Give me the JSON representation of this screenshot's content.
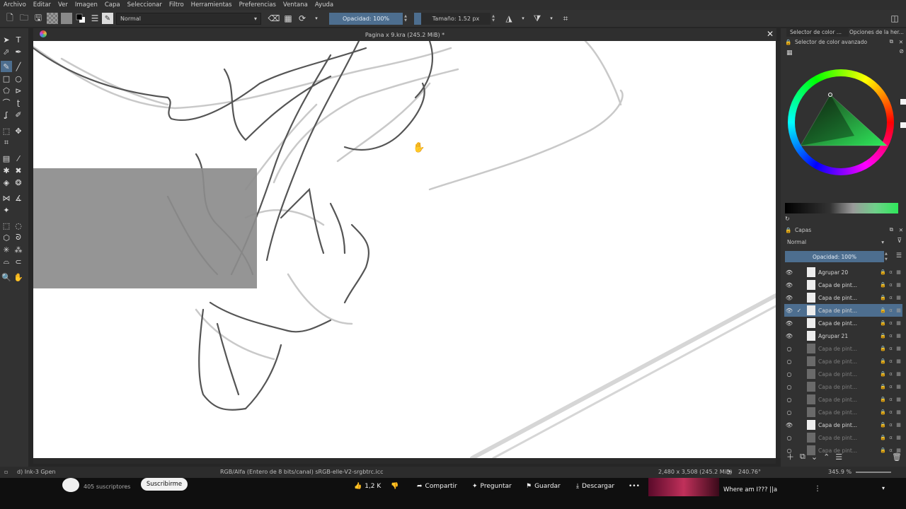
{
  "menu": [
    "Archivo",
    "Editar",
    "Ver",
    "Imagen",
    "Capa",
    "Seleccionar",
    "Filtro",
    "Herramientas",
    "Preferencias",
    "Ventana",
    "Ayuda"
  ],
  "toolbar": {
    "blend_mode": "Normal",
    "opacity_label": "Opacidad: 100%",
    "opacity_value": 1.0,
    "size_label": "Tamaño: 1.52 px"
  },
  "document": {
    "title": "Pagina x 9.kra (245.2 MiB) *"
  },
  "dockers": {
    "tab1": "Selector de color ...",
    "tab2": "Opciones de la her...",
    "color_selector_title": "Selector de color avanzado",
    "layers_title": "Capas",
    "layers_blend": "Normal",
    "layers_opacity": "Opacidad:  100%"
  },
  "layers": [
    {
      "name": "Agrupar 20",
      "visible": true,
      "dim": false,
      "selected": false,
      "group": true
    },
    {
      "name": "Capa de pint...",
      "visible": true,
      "dim": false,
      "selected": false,
      "group": false
    },
    {
      "name": "Capa de pint...",
      "visible": true,
      "dim": false,
      "selected": false,
      "group": false
    },
    {
      "name": "Capa de pint...",
      "visible": true,
      "dim": false,
      "selected": true,
      "group": false
    },
    {
      "name": "Capa de pint...",
      "visible": true,
      "dim": false,
      "selected": false,
      "group": false
    },
    {
      "name": "Agrupar 21",
      "visible": true,
      "dim": false,
      "selected": false,
      "group": true
    },
    {
      "name": "Capa de pint...",
      "visible": false,
      "dim": true,
      "selected": false,
      "group": false
    },
    {
      "name": "Capa de pint...",
      "visible": false,
      "dim": true,
      "selected": false,
      "group": false
    },
    {
      "name": "Capa de pint...",
      "visible": false,
      "dim": true,
      "selected": false,
      "group": false
    },
    {
      "name": "Capa de pint...",
      "visible": false,
      "dim": true,
      "selected": false,
      "group": false
    },
    {
      "name": "Capa de pint...",
      "visible": false,
      "dim": true,
      "selected": false,
      "group": false
    },
    {
      "name": "Capa de pint...",
      "visible": false,
      "dim": true,
      "selected": false,
      "group": false
    },
    {
      "name": "Capa de pint...",
      "visible": true,
      "dim": false,
      "selected": false,
      "group": false
    },
    {
      "name": "Capa de pint...",
      "visible": false,
      "dim": true,
      "selected": false,
      "group": false
    },
    {
      "name": "Capa de pint...",
      "visible": false,
      "dim": true,
      "selected": false,
      "group": false
    }
  ],
  "status": {
    "brush": "d) Ink-3 Gpen",
    "color_space": "RGB/Alfa (Entero de 8 bits/canal)  sRGB-elle-V2-srgbtrc.icc",
    "image_size": "2,480 x 3,508 (245.2 MiB)",
    "rotation": "240.76°",
    "zoom": "345.9 %"
  },
  "youtube": {
    "subscribers": "405 suscriptores",
    "subscribe": "Suscribirme",
    "likes": "1,2 K",
    "share": "Compartir",
    "ask": "Preguntar",
    "save": "Guardar",
    "download": "Descargar",
    "more": "•••",
    "next_title": "Where am I??? ||a"
  },
  "colors": {
    "accent": "#4d6e8f",
    "panel": "#313131",
    "canvas": "#ffffff",
    "selection_fill": "#8c8c8c"
  }
}
